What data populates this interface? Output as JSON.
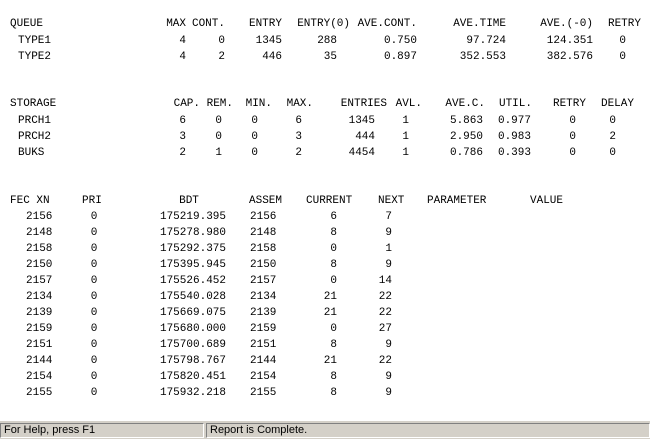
{
  "queue": {
    "headers": [
      "QUEUE",
      "MAX",
      "CONT.",
      "ENTRY",
      "ENTRY(0)",
      "AVE.CONT.",
      "AVE.TIME",
      "AVE.(-0)",
      "RETRY"
    ],
    "rows": [
      [
        "TYPE1",
        "4",
        "0",
        "1345",
        "288",
        "0.750",
        "97.724",
        "124.351",
        "0"
      ],
      [
        "TYPE2",
        "4",
        "2",
        "446",
        "35",
        "0.897",
        "352.553",
        "382.576",
        "0"
      ]
    ]
  },
  "storage": {
    "headers": [
      "STORAGE",
      "CAP.",
      "REM.",
      "MIN.",
      "MAX.",
      "ENTRIES",
      "AVL.",
      "AVE.C.",
      "UTIL.",
      "RETRY",
      "DELAY"
    ],
    "rows": [
      [
        "PRCH1",
        "6",
        "0",
        "0",
        "6",
        "1345",
        "1",
        "5.863",
        "0.977",
        "0",
        "0"
      ],
      [
        "PRCH2",
        "3",
        "0",
        "0",
        "3",
        "444",
        "1",
        "2.950",
        "0.983",
        "0",
        "2"
      ],
      [
        "BUKS",
        "2",
        "1",
        "0",
        "2",
        "4454",
        "1",
        "0.786",
        "0.393",
        "0",
        "0"
      ]
    ]
  },
  "fec": {
    "headers": [
      "FEC XN",
      "PRI",
      "BDT",
      "ASSEM",
      "CURRENT",
      "NEXT",
      "PARAMETER",
      "VALUE"
    ],
    "rows": [
      [
        "2156",
        "0",
        "175219.395",
        "2156",
        "6",
        "7"
      ],
      [
        "2148",
        "0",
        "175278.980",
        "2148",
        "8",
        "9"
      ],
      [
        "2158",
        "0",
        "175292.375",
        "2158",
        "0",
        "1"
      ],
      [
        "2150",
        "0",
        "175395.945",
        "2150",
        "8",
        "9"
      ],
      [
        "2157",
        "0",
        "175526.452",
        "2157",
        "0",
        "14"
      ],
      [
        "2134",
        "0",
        "175540.028",
        "2134",
        "21",
        "22"
      ],
      [
        "2139",
        "0",
        "175669.075",
        "2139",
        "21",
        "22"
      ],
      [
        "2159",
        "0",
        "175680.000",
        "2159",
        "0",
        "27"
      ],
      [
        "2151",
        "0",
        "175700.689",
        "2151",
        "8",
        "9"
      ],
      [
        "2144",
        "0",
        "175798.767",
        "2144",
        "21",
        "22"
      ],
      [
        "2154",
        "0",
        "175820.451",
        "2154",
        "8",
        "9"
      ],
      [
        "2155",
        "0",
        "175932.218",
        "2155",
        "8",
        "9"
      ]
    ]
  },
  "statusbar": {
    "help": "For Help, press F1",
    "status": "Report is Complete."
  }
}
